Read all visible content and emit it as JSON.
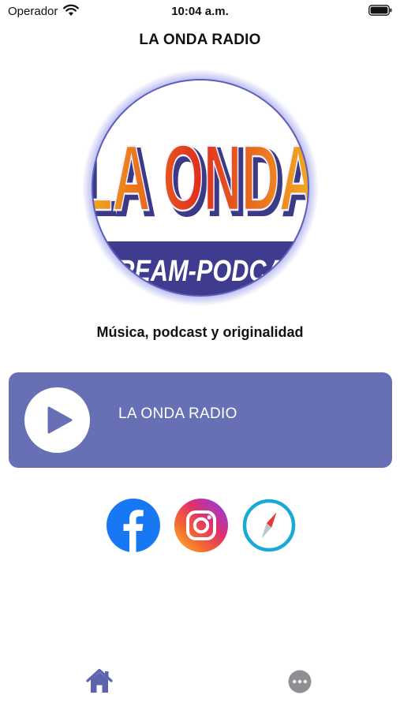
{
  "status_bar": {
    "carrier": "Operador",
    "time": "10:04 a.m."
  },
  "header": {
    "title": "LA ONDA RADIO"
  },
  "logo": {
    "line1": "LA ONDA",
    "line2": "STREAM-PODCAST"
  },
  "subtitle": "Música, podcast y originalidad",
  "player": {
    "station_name": "LA ONDA RADIO",
    "play_icon": "play-icon",
    "card_color": "#6770b5"
  },
  "social": {
    "items": [
      {
        "name": "facebook",
        "icon": "facebook-icon",
        "color": "#1877f2"
      },
      {
        "name": "instagram",
        "icon": "instagram-icon",
        "color": "#e1306c"
      },
      {
        "name": "web",
        "icon": "compass-icon",
        "color": "#1ba9d6"
      }
    ]
  },
  "tab_bar": {
    "items": [
      {
        "name": "home",
        "icon": "home-icon",
        "color": "#5b63ad"
      },
      {
        "name": "more",
        "icon": "more-icon",
        "color": "#8e8e93"
      }
    ]
  }
}
